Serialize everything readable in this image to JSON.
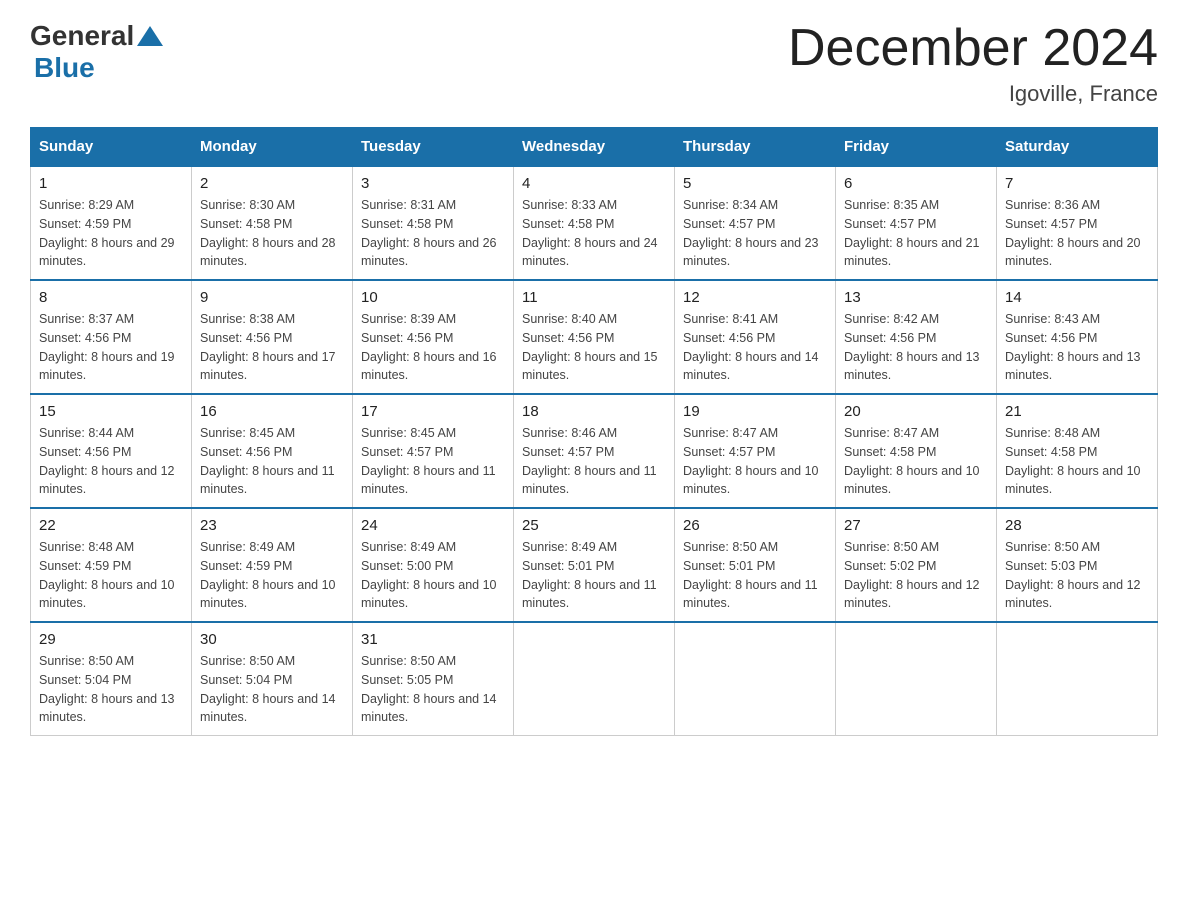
{
  "header": {
    "logo_general": "General",
    "logo_blue": "Blue",
    "title": "December 2024",
    "subtitle": "Igoville, France"
  },
  "weekdays": [
    "Sunday",
    "Monday",
    "Tuesday",
    "Wednesday",
    "Thursday",
    "Friday",
    "Saturday"
  ],
  "weeks": [
    [
      {
        "day": "1",
        "sunrise": "8:29 AM",
        "sunset": "4:59 PM",
        "daylight": "8 hours and 29 minutes."
      },
      {
        "day": "2",
        "sunrise": "8:30 AM",
        "sunset": "4:58 PM",
        "daylight": "8 hours and 28 minutes."
      },
      {
        "day": "3",
        "sunrise": "8:31 AM",
        "sunset": "4:58 PM",
        "daylight": "8 hours and 26 minutes."
      },
      {
        "day": "4",
        "sunrise": "8:33 AM",
        "sunset": "4:58 PM",
        "daylight": "8 hours and 24 minutes."
      },
      {
        "day": "5",
        "sunrise": "8:34 AM",
        "sunset": "4:57 PM",
        "daylight": "8 hours and 23 minutes."
      },
      {
        "day": "6",
        "sunrise": "8:35 AM",
        "sunset": "4:57 PM",
        "daylight": "8 hours and 21 minutes."
      },
      {
        "day": "7",
        "sunrise": "8:36 AM",
        "sunset": "4:57 PM",
        "daylight": "8 hours and 20 minutes."
      }
    ],
    [
      {
        "day": "8",
        "sunrise": "8:37 AM",
        "sunset": "4:56 PM",
        "daylight": "8 hours and 19 minutes."
      },
      {
        "day": "9",
        "sunrise": "8:38 AM",
        "sunset": "4:56 PM",
        "daylight": "8 hours and 17 minutes."
      },
      {
        "day": "10",
        "sunrise": "8:39 AM",
        "sunset": "4:56 PM",
        "daylight": "8 hours and 16 minutes."
      },
      {
        "day": "11",
        "sunrise": "8:40 AM",
        "sunset": "4:56 PM",
        "daylight": "8 hours and 15 minutes."
      },
      {
        "day": "12",
        "sunrise": "8:41 AM",
        "sunset": "4:56 PM",
        "daylight": "8 hours and 14 minutes."
      },
      {
        "day": "13",
        "sunrise": "8:42 AM",
        "sunset": "4:56 PM",
        "daylight": "8 hours and 13 minutes."
      },
      {
        "day": "14",
        "sunrise": "8:43 AM",
        "sunset": "4:56 PM",
        "daylight": "8 hours and 13 minutes."
      }
    ],
    [
      {
        "day": "15",
        "sunrise": "8:44 AM",
        "sunset": "4:56 PM",
        "daylight": "8 hours and 12 minutes."
      },
      {
        "day": "16",
        "sunrise": "8:45 AM",
        "sunset": "4:56 PM",
        "daylight": "8 hours and 11 minutes."
      },
      {
        "day": "17",
        "sunrise": "8:45 AM",
        "sunset": "4:57 PM",
        "daylight": "8 hours and 11 minutes."
      },
      {
        "day": "18",
        "sunrise": "8:46 AM",
        "sunset": "4:57 PM",
        "daylight": "8 hours and 11 minutes."
      },
      {
        "day": "19",
        "sunrise": "8:47 AM",
        "sunset": "4:57 PM",
        "daylight": "8 hours and 10 minutes."
      },
      {
        "day": "20",
        "sunrise": "8:47 AM",
        "sunset": "4:58 PM",
        "daylight": "8 hours and 10 minutes."
      },
      {
        "day": "21",
        "sunrise": "8:48 AM",
        "sunset": "4:58 PM",
        "daylight": "8 hours and 10 minutes."
      }
    ],
    [
      {
        "day": "22",
        "sunrise": "8:48 AM",
        "sunset": "4:59 PM",
        "daylight": "8 hours and 10 minutes."
      },
      {
        "day": "23",
        "sunrise": "8:49 AM",
        "sunset": "4:59 PM",
        "daylight": "8 hours and 10 minutes."
      },
      {
        "day": "24",
        "sunrise": "8:49 AM",
        "sunset": "5:00 PM",
        "daylight": "8 hours and 10 minutes."
      },
      {
        "day": "25",
        "sunrise": "8:49 AM",
        "sunset": "5:01 PM",
        "daylight": "8 hours and 11 minutes."
      },
      {
        "day": "26",
        "sunrise": "8:50 AM",
        "sunset": "5:01 PM",
        "daylight": "8 hours and 11 minutes."
      },
      {
        "day": "27",
        "sunrise": "8:50 AM",
        "sunset": "5:02 PM",
        "daylight": "8 hours and 12 minutes."
      },
      {
        "day": "28",
        "sunrise": "8:50 AM",
        "sunset": "5:03 PM",
        "daylight": "8 hours and 12 minutes."
      }
    ],
    [
      {
        "day": "29",
        "sunrise": "8:50 AM",
        "sunset": "5:04 PM",
        "daylight": "8 hours and 13 minutes."
      },
      {
        "day": "30",
        "sunrise": "8:50 AM",
        "sunset": "5:04 PM",
        "daylight": "8 hours and 14 minutes."
      },
      {
        "day": "31",
        "sunrise": "8:50 AM",
        "sunset": "5:05 PM",
        "daylight": "8 hours and 14 minutes."
      },
      null,
      null,
      null,
      null
    ]
  ]
}
